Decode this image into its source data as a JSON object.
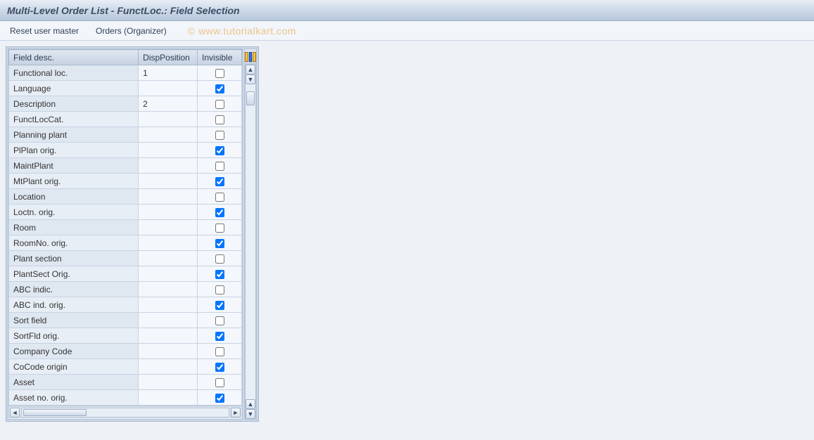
{
  "header": {
    "title": "Multi-Level Order List - FunctLoc.: Field Selection"
  },
  "toolbar": {
    "reset_label": "Reset user master",
    "orders_label": "Orders (Organizer)"
  },
  "watermark": "© www.tutorialkart.com",
  "table": {
    "columns": {
      "field_desc": "Field desc.",
      "disp_position": "DispPosition",
      "invisible": "Invisible"
    },
    "rows": [
      {
        "desc": "Functional loc.",
        "pos": "1",
        "inv": false
      },
      {
        "desc": "Language",
        "pos": "",
        "inv": true
      },
      {
        "desc": "Description",
        "pos": "2",
        "inv": false
      },
      {
        "desc": "FunctLocCat.",
        "pos": "",
        "inv": false
      },
      {
        "desc": "Planning plant",
        "pos": "",
        "inv": false
      },
      {
        "desc": "PlPlan orig.",
        "pos": "",
        "inv": true
      },
      {
        "desc": "MaintPlant",
        "pos": "",
        "inv": false
      },
      {
        "desc": "MtPlant orig.",
        "pos": "",
        "inv": true
      },
      {
        "desc": "Location",
        "pos": "",
        "inv": false
      },
      {
        "desc": "Loctn. orig.",
        "pos": "",
        "inv": true
      },
      {
        "desc": "Room",
        "pos": "",
        "inv": false
      },
      {
        "desc": "RoomNo. orig.",
        "pos": "",
        "inv": true
      },
      {
        "desc": "Plant section",
        "pos": "",
        "inv": false
      },
      {
        "desc": "PlantSect Orig.",
        "pos": "",
        "inv": true
      },
      {
        "desc": "ABC indic.",
        "pos": "",
        "inv": false
      },
      {
        "desc": "ABC ind. orig.",
        "pos": "",
        "inv": true
      },
      {
        "desc": "Sort field",
        "pos": "",
        "inv": false
      },
      {
        "desc": "SortFld orig.",
        "pos": "",
        "inv": true
      },
      {
        "desc": "Company Code",
        "pos": "",
        "inv": false
      },
      {
        "desc": "CoCode origin",
        "pos": "",
        "inv": true
      },
      {
        "desc": "Asset",
        "pos": "",
        "inv": false
      },
      {
        "desc": "Asset no. orig.",
        "pos": "",
        "inv": true
      }
    ]
  }
}
